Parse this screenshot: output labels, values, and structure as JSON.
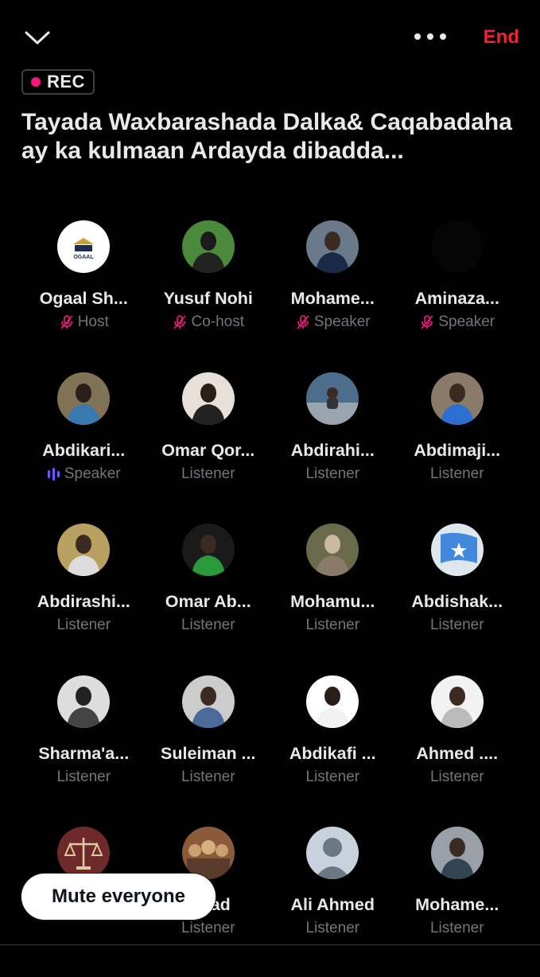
{
  "header": {
    "end_label": "End",
    "rec_label": "REC",
    "title": "Tayada Waxbarashada Dalka& Caqabadaha ay ka kulmaan Ardayda dibadda..."
  },
  "participants": [
    {
      "name": "Ogaal Sh...",
      "role": "Host",
      "status": "muted"
    },
    {
      "name": "Yusuf Nohi",
      "role": "Co-host",
      "status": "muted"
    },
    {
      "name": "Mohame...",
      "role": "Speaker",
      "status": "muted"
    },
    {
      "name": "Aminaza...",
      "role": "Speaker",
      "status": "muted"
    },
    {
      "name": "Abdikari...",
      "role": "Speaker",
      "status": "speaking"
    },
    {
      "name": "Omar Qor...",
      "role": "Listener",
      "status": "none"
    },
    {
      "name": "Abdirahi...",
      "role": "Listener",
      "status": "none"
    },
    {
      "name": "Abdimaji...",
      "role": "Listener",
      "status": "none"
    },
    {
      "name": "Abdirashi...",
      "role": "Listener",
      "status": "none"
    },
    {
      "name": "Omar Ab...",
      "role": "Listener",
      "status": "none"
    },
    {
      "name": "Mohamu...",
      "role": "Listener",
      "status": "none"
    },
    {
      "name": "Abdishak...",
      "role": "Listener",
      "status": "none"
    },
    {
      "name": "Sharma'a...",
      "role": "Listener",
      "status": "none"
    },
    {
      "name": "Suleiman ...",
      "role": "Listener",
      "status": "none"
    },
    {
      "name": "Abdikafi ...",
      "role": "Listener",
      "status": "none"
    },
    {
      "name": "Ahmed ....",
      "role": "Listener",
      "status": "none"
    },
    {
      "name": "",
      "role": "Listener",
      "status": "none"
    },
    {
      "name": "...had",
      "role": "Listener",
      "status": "none"
    },
    {
      "name": "Ali Ahmed",
      "role": "Listener",
      "status": "none"
    },
    {
      "name": "Mohame...",
      "role": "Listener",
      "status": "none"
    }
  ],
  "mute_button_label": "Mute everyone",
  "colors": {
    "end": "#f4212e",
    "rec_dot": "#f91880",
    "muted": "#f91880",
    "speaking": "#7856ff"
  }
}
